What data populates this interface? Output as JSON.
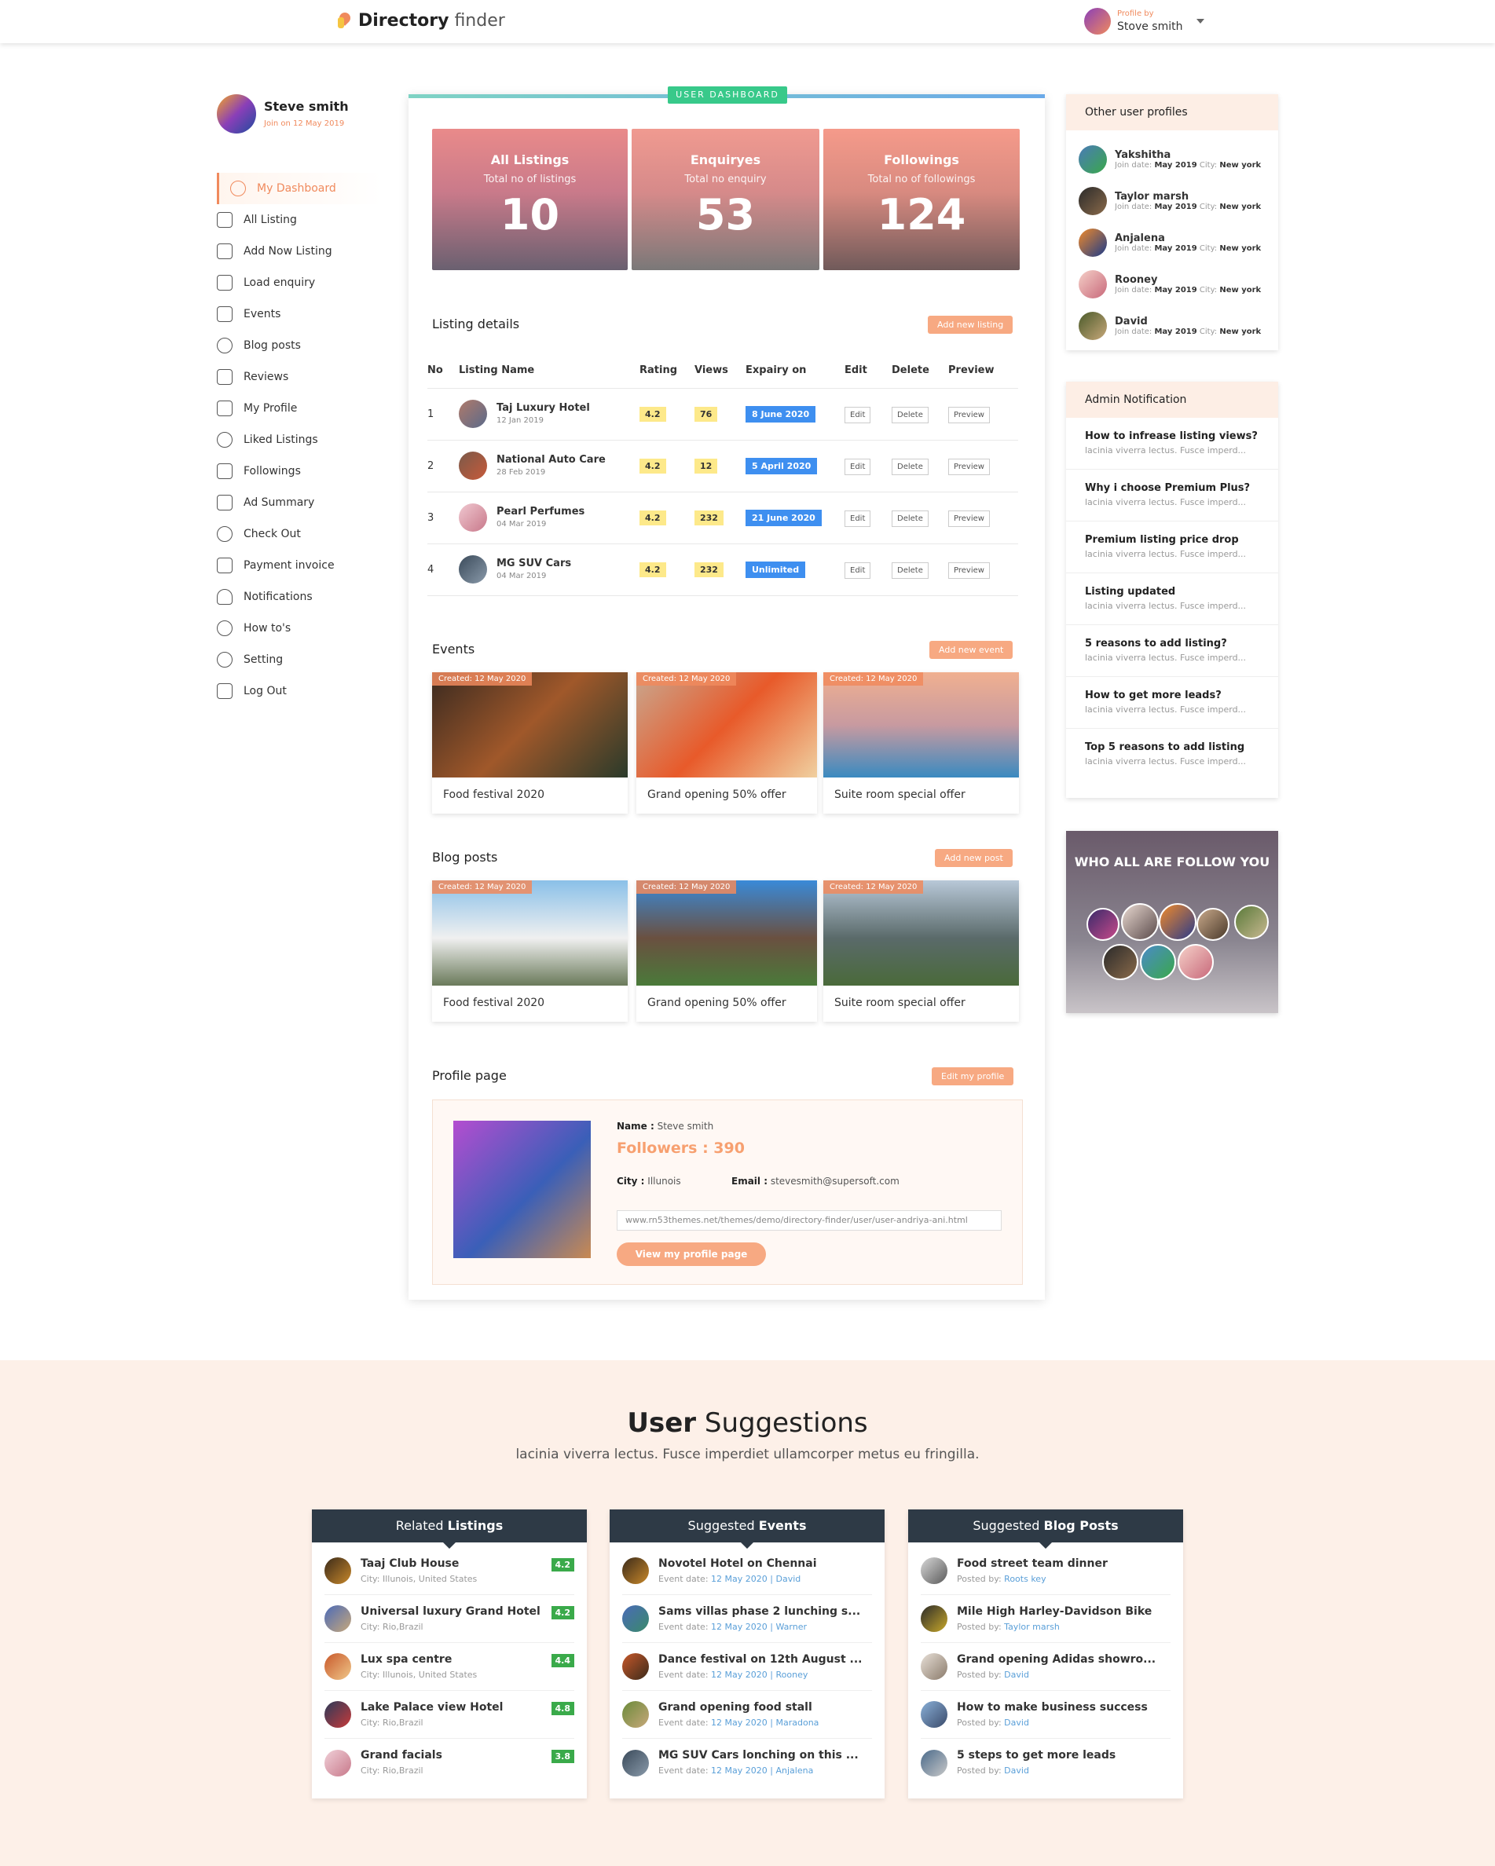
{
  "header": {
    "brand_bold": "Directory",
    "brand_rest": "finder",
    "profile_by": "Profile by",
    "profile_name": "Stove smith"
  },
  "user": {
    "name": "Steve smith",
    "join": "Join on 12 May 2019"
  },
  "menu": [
    "My Dashboard",
    "All Listing",
    "Add Now Listing",
    "Load enquiry",
    "Events",
    "Blog posts",
    "Reviews",
    "My Profile",
    "Liked Listings",
    "Followings",
    "Ad Summary",
    "Check Out",
    "Payment invoice",
    "Notifications",
    "How to's",
    "Setting",
    "Log Out"
  ],
  "dashboard_tag": "USER DASHBOARD",
  "stats": [
    {
      "title": "All Listings",
      "sub": "Total no of listings",
      "num": "10"
    },
    {
      "title": "Enquiryes",
      "sub": "Total no enquiry",
      "num": "53"
    },
    {
      "title": "Followings",
      "sub": "Total no of followings",
      "num": "124"
    }
  ],
  "listing": {
    "title": "Listing details",
    "add": "Add new listing",
    "cols": [
      "No",
      "Listing Name",
      "Rating",
      "Views",
      "Expairy on",
      "Edit",
      "Delete",
      "Preview"
    ],
    "rows": [
      {
        "no": "1",
        "name": "Taj Luxury Hotel",
        "date": "12 Jan 2019",
        "rating": "4.2",
        "views": "76",
        "exp": "8 June 2020"
      },
      {
        "no": "2",
        "name": "National Auto Care",
        "date": "28 Feb 2019",
        "rating": "4.2",
        "views": "12",
        "exp": "5 April 2020"
      },
      {
        "no": "3",
        "name": "Pearl Perfumes",
        "date": "04 Mar 2019",
        "rating": "4.2",
        "views": "232",
        "exp": "21 June 2020"
      },
      {
        "no": "4",
        "name": "MG SUV Cars",
        "date": "04 Mar 2019",
        "rating": "4.2",
        "views": "232",
        "exp": "Unlimited"
      }
    ],
    "edit": "Edit",
    "delete": "Delete",
    "preview": "Preview"
  },
  "events": {
    "title": "Events",
    "add": "Add new event",
    "items": [
      {
        "created": "Created: 12 May 2020",
        "name": "Food festival 2020"
      },
      {
        "created": "Created: 12 May 2020",
        "name": "Grand opening 50% offer"
      },
      {
        "created": "Created: 12 May 2020",
        "name": "Suite room special offer"
      }
    ]
  },
  "blog": {
    "title": "Blog posts",
    "add": "Add new post",
    "items": [
      {
        "created": "Created: 12 May 2020",
        "name": "Food festival 2020"
      },
      {
        "created": "Created: 12 May 2020",
        "name": "Grand opening 50% offer"
      },
      {
        "created": "Created: 12 May 2020",
        "name": "Suite room special offer"
      }
    ]
  },
  "profile": {
    "title": "Profile page",
    "edit": "Edit my profile",
    "name_label": "Name :",
    "name": "Steve smith",
    "followers": "Followers : 390",
    "city_label": "City :",
    "city": "Illunois",
    "email_label": "Email :",
    "email": "stevesmith@supersoft.com",
    "url": "www.rn53themes.net/themes/demo/directory-finder/user/user-andriya-ani.html",
    "view": "View my profile page"
  },
  "other_profiles": {
    "title": "Other user profiles",
    "items": [
      {
        "name": "Yakshitha",
        "join": "May 2019",
        "city": "New york"
      },
      {
        "name": "Taylor marsh",
        "join": "May 2019",
        "city": "New york"
      },
      {
        "name": "Anjalena",
        "join": "May 2019",
        "city": "New york"
      },
      {
        "name": "Rooney",
        "join": "May 2019",
        "city": "New york"
      },
      {
        "name": "David",
        "join": "May 2019",
        "city": "New york"
      }
    ],
    "join_label": "Join date:",
    "city_label": "City:"
  },
  "admin": {
    "title": "Admin Notification",
    "desc": "lacinia viverra lectus. Fusce imperd...",
    "items": [
      "How to infrease listing views?",
      "Why i choose Premium Plus?",
      "Premium listing price drop",
      "Listing updated",
      "5 reasons to add listing?",
      "How to get more leads?",
      "Top 5 reasons to add listing"
    ]
  },
  "follow": {
    "title": "WHO ALL ARE FOLLOW YOU"
  },
  "suggestions": {
    "title_bold": "User",
    "title_rest": "Suggestions",
    "sub": "lacinia viverra lectus. Fusce imperdiet ullamcorper metus eu fringilla.",
    "related": {
      "h1": "Related",
      "h2": "Listings",
      "items": [
        {
          "name": "Taaj Club House",
          "sub": "City: Illunois, United States",
          "rate": "4.2"
        },
        {
          "name": "Universal luxury Grand Hotel",
          "sub": "City: Rio,Brazil",
          "rate": "4.2"
        },
        {
          "name": "Lux spa centre",
          "sub": "City: Illunois, United States",
          "rate": "4.4"
        },
        {
          "name": "Lake Palace view Hotel",
          "sub": "City: Rio,Brazil",
          "rate": "4.8"
        },
        {
          "name": "Grand facials",
          "sub": "City: Rio,Brazil",
          "rate": "3.8"
        }
      ]
    },
    "events": {
      "h1": "Suggested",
      "h2": "Events",
      "label": "Event date:",
      "items": [
        {
          "name": "Novotel Hotel on Chennai",
          "date": "12 May 2020",
          "by": "David"
        },
        {
          "name": "Sams villas phase 2 lunching s...",
          "date": "12 May 2020",
          "by": "Warner"
        },
        {
          "name": "Dance festival on 12th August ...",
          "date": "12 May 2020",
          "by": "Rooney"
        },
        {
          "name": "Grand opening food stall",
          "date": "12 May 2020",
          "by": "Maradona"
        },
        {
          "name": "MG SUV Cars lonching on this ...",
          "date": "12 May 2020",
          "by": "Anjalena"
        }
      ]
    },
    "blog": {
      "h1": "Suggested",
      "h2": "Blog Posts",
      "label": "Posted by:",
      "items": [
        {
          "name": "Food street team dinner",
          "by": "Roots key"
        },
        {
          "name": "Mile High Harley-Davidson Bike",
          "by": "Taylor marsh"
        },
        {
          "name": "Grand opening Adidas showro...",
          "by": "David"
        },
        {
          "name": "How to make business success",
          "by": "David"
        },
        {
          "name": "5 steps to get more leads",
          "by": "David"
        }
      ]
    }
  }
}
